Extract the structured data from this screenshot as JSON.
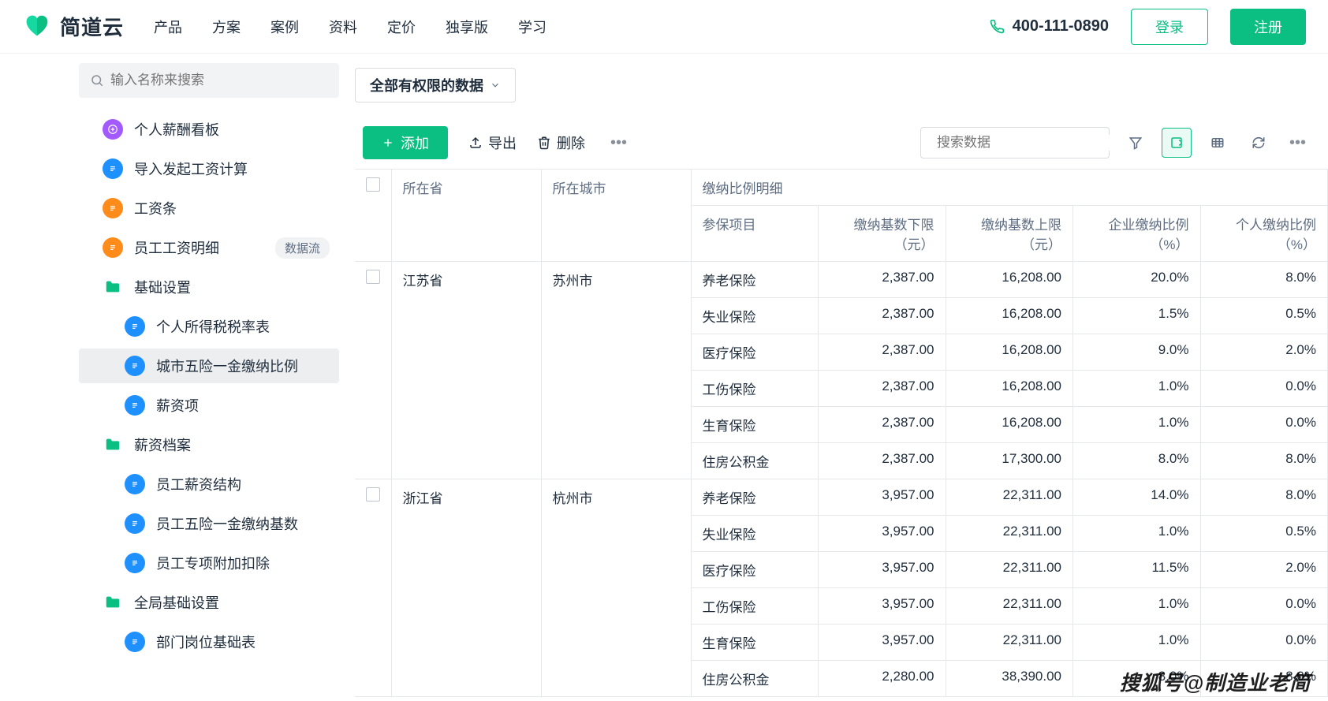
{
  "nav": {
    "brand": "简道云",
    "items": [
      "产品",
      "方案",
      "案例",
      "资料",
      "定价",
      "独享版",
      "学习"
    ],
    "phone": "400-111-0890",
    "login": "登录",
    "register": "注册"
  },
  "sidebar": {
    "search_placeholder": "输入名称来搜索",
    "items": [
      {
        "icon": "purple-doc",
        "label": "个人薪酬看板",
        "level": 1
      },
      {
        "icon": "blue-doc",
        "label": "导入发起工资计算",
        "level": 1
      },
      {
        "icon": "orange-doc",
        "label": "工资条",
        "level": 1
      },
      {
        "icon": "orange-doc",
        "label": "员工工资明细",
        "level": 1,
        "tag": "数据流"
      },
      {
        "icon": "folder",
        "label": "基础设置",
        "level": 1
      },
      {
        "icon": "blue-doc",
        "label": "个人所得税税率表",
        "level": 2
      },
      {
        "icon": "blue-doc",
        "label": "城市五险一金缴纳比例",
        "level": 2,
        "selected": true
      },
      {
        "icon": "blue-doc",
        "label": "薪资项",
        "level": 2
      },
      {
        "icon": "folder",
        "label": "薪资档案",
        "level": 1
      },
      {
        "icon": "blue-doc",
        "label": "员工薪资结构",
        "level": 2
      },
      {
        "icon": "blue-doc",
        "label": "员工五险一金缴纳基数",
        "level": 2
      },
      {
        "icon": "blue-doc",
        "label": "员工专项附加扣除",
        "level": 2
      },
      {
        "icon": "folder",
        "label": "全局基础设置",
        "level": 1
      },
      {
        "icon": "blue-doc",
        "label": "部门岗位基础表",
        "level": 2
      }
    ]
  },
  "main": {
    "scope": "全部有权限的数据",
    "toolbar": {
      "add": "添加",
      "export": "导出",
      "delete": "删除",
      "search_placeholder": "搜索数据"
    },
    "table": {
      "header_group": "缴纳比例明细",
      "headers": {
        "province": "所在省",
        "city": "所在城市",
        "item": "参保项目",
        "base_min": "缴纳基数下限（元）",
        "base_max": "缴纳基数上限（元）",
        "corp_pct": "企业缴纳比例（%）",
        "pers_pct": "个人缴纳比例（%）"
      },
      "groups": [
        {
          "province": "江苏省",
          "city": "苏州市",
          "rows": [
            {
              "item": "养老保险",
              "min": "2,387.00",
              "max": "16,208.00",
              "corp": "20.0%",
              "pers": "8.0%"
            },
            {
              "item": "失业保险",
              "min": "2,387.00",
              "max": "16,208.00",
              "corp": "1.5%",
              "pers": "0.5%"
            },
            {
              "item": "医疗保险",
              "min": "2,387.00",
              "max": "16,208.00",
              "corp": "9.0%",
              "pers": "2.0%"
            },
            {
              "item": "工伤保险",
              "min": "2,387.00",
              "max": "16,208.00",
              "corp": "1.0%",
              "pers": "0.0%"
            },
            {
              "item": "生育保险",
              "min": "2,387.00",
              "max": "16,208.00",
              "corp": "1.0%",
              "pers": "0.0%"
            },
            {
              "item": "住房公积金",
              "min": "2,387.00",
              "max": "17,300.00",
              "corp": "8.0%",
              "pers": "8.0%"
            }
          ]
        },
        {
          "province": "浙江省",
          "city": "杭州市",
          "rows": [
            {
              "item": "养老保险",
              "min": "3,957.00",
              "max": "22,311.00",
              "corp": "14.0%",
              "pers": "8.0%"
            },
            {
              "item": "失业保险",
              "min": "3,957.00",
              "max": "22,311.00",
              "corp": "1.0%",
              "pers": "0.5%"
            },
            {
              "item": "医疗保险",
              "min": "3,957.00",
              "max": "22,311.00",
              "corp": "11.5%",
              "pers": "2.0%"
            },
            {
              "item": "工伤保险",
              "min": "3,957.00",
              "max": "22,311.00",
              "corp": "1.0%",
              "pers": "0.0%"
            },
            {
              "item": "生育保险",
              "min": "3,957.00",
              "max": "22,311.00",
              "corp": "1.0%",
              "pers": "0.0%"
            },
            {
              "item": "住房公积金",
              "min": "2,280.00",
              "max": "38,390.00",
              "corp": "8.0%",
              "pers": "8.0%"
            }
          ]
        }
      ]
    }
  },
  "watermark": "搜狐号@制造业老简"
}
